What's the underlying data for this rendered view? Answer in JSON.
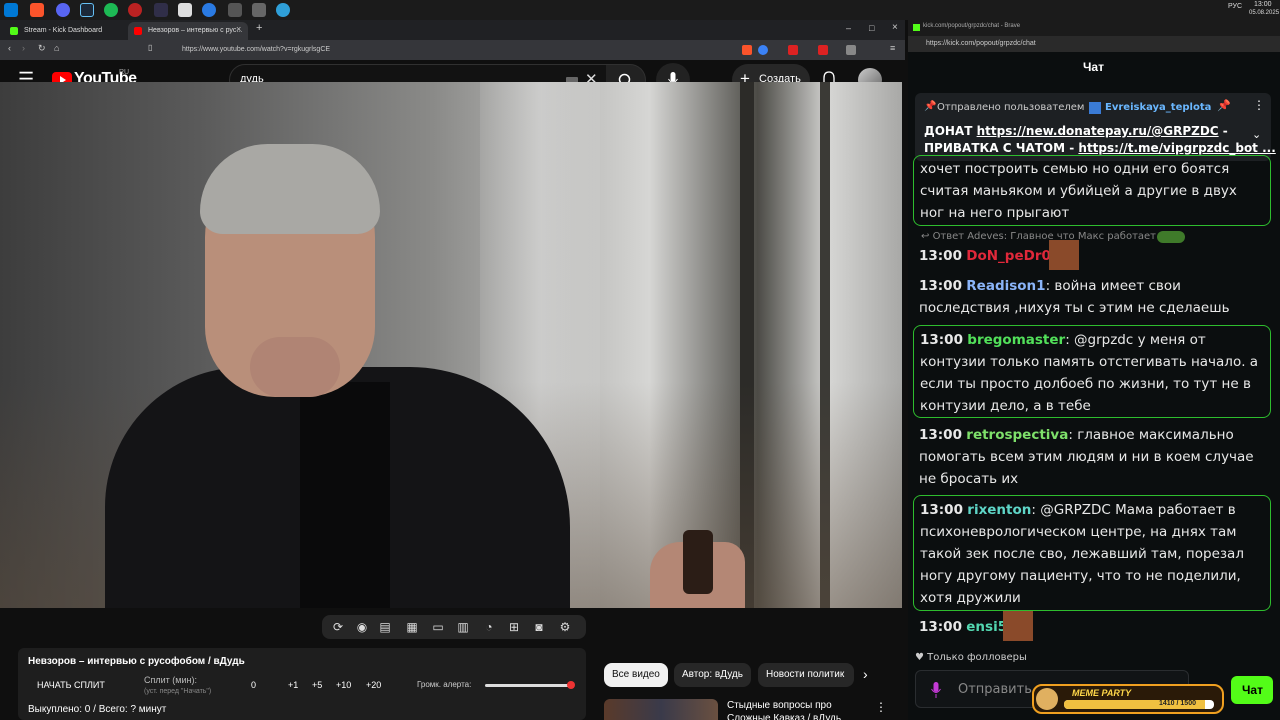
{
  "taskbar": {
    "lang": "РУС",
    "time": "13:00",
    "date": "05.08.2025"
  },
  "browser": {
    "tabs": [
      {
        "label": "Stream - Kick Dashboard"
      },
      {
        "label": "Невзоров – интервью с рус...",
        "close": "×"
      }
    ],
    "new_tab": "+",
    "url": "https://www.youtube.com/watch?v=rgkugrlsgCE",
    "window_controls": {
      "min": "–",
      "max": "□",
      "close": "×"
    }
  },
  "youtube": {
    "logo": "YouTube",
    "region": "RU",
    "search_value": "дудь",
    "create_label": "Создать"
  },
  "overlay_panel": {
    "title": "Невзоров – интервью с русофобом / вДудь",
    "start_split": "НАЧАТЬ СПЛИТ",
    "split_label": "Сплит (мин):",
    "split_hint": "(уст. перед \"Начать\")",
    "split_value": "0",
    "buttons": [
      "+1",
      "+5",
      "+10",
      "+20"
    ],
    "volume_label": "Громк. алерта:",
    "volume_level": 0.97,
    "bought": "Выкуплено: 0 / Всего: ? минут"
  },
  "chips": [
    "Все видео",
    "Автор: вДудь",
    "Новости политик"
  ],
  "related": {
    "title": "Стыдные вопросы про",
    "title2": "Сложные Кавказ / вДудь"
  },
  "chat_window": {
    "title": "kick.com/popout/grpzdc/chat - Brave",
    "url": "https://kick.com/popout/grpzdc/chat",
    "header": "Чат"
  },
  "pinned": {
    "prefix": "Отправлено пользователем",
    "user": "Evreiskaya_teplota",
    "line1_label": "ДОНАТ ",
    "line1_link": "https://new.donatepay.ru/@GRPZDC",
    "line1_tail": " -",
    "line2_label": "ПРИВАТКА С ЧАТОМ - ",
    "line2_link": "https://t.me/vipgrpzdc_bot ..."
  },
  "messages": [
    {
      "text": "хочет построить семью но одни его боятся считая маньяком и убийцей а другие в двух ног на него прыгают"
    },
    {
      "reply": "Ответ Adeves: Главное что Макс работает",
      "time": "13:00",
      "user": "DoN_peDr0",
      "color": "#e0283a",
      "text": ""
    },
    {
      "time": "13:00",
      "user": "Readison1",
      "color": "#8ab4f8",
      "text": "война имеет свои последствия ,нихуя ты с этим не сделаешь"
    },
    {
      "time": "13:00",
      "user": "bregomaster",
      "color": "#52e05a",
      "text": "@grpzdc у меня от контузии только память отстегивать начало. а если ты просто долбоеб по жизни, то тут не в контузии дело, а в тебе"
    },
    {
      "time": "13:00",
      "user": "retrospectiva",
      "color": "#7ee06a",
      "text": "главное максимально помогать всем этим людям и ни в коем случае не бросать их"
    },
    {
      "time": "13:00",
      "user": "rixenton",
      "color": "#5fd6c8",
      "text": "@GRPZDC Мама работает в психоневрологическом центре, на днях там такой зек после сво, лежавший там, порезал ногу другому пациенту, что то не поделили, хотя дружили"
    },
    {
      "time": "13:00",
      "user": "ensi5",
      "color": "#53d7b0",
      "text": ""
    }
  ],
  "followers_only": "Только фолловеры",
  "chat_input_placeholder": "Отправить со...",
  "chat_send": "Чат",
  "meme": {
    "label": "MEME PARTY",
    "progress_text": "1410 / 1500"
  }
}
